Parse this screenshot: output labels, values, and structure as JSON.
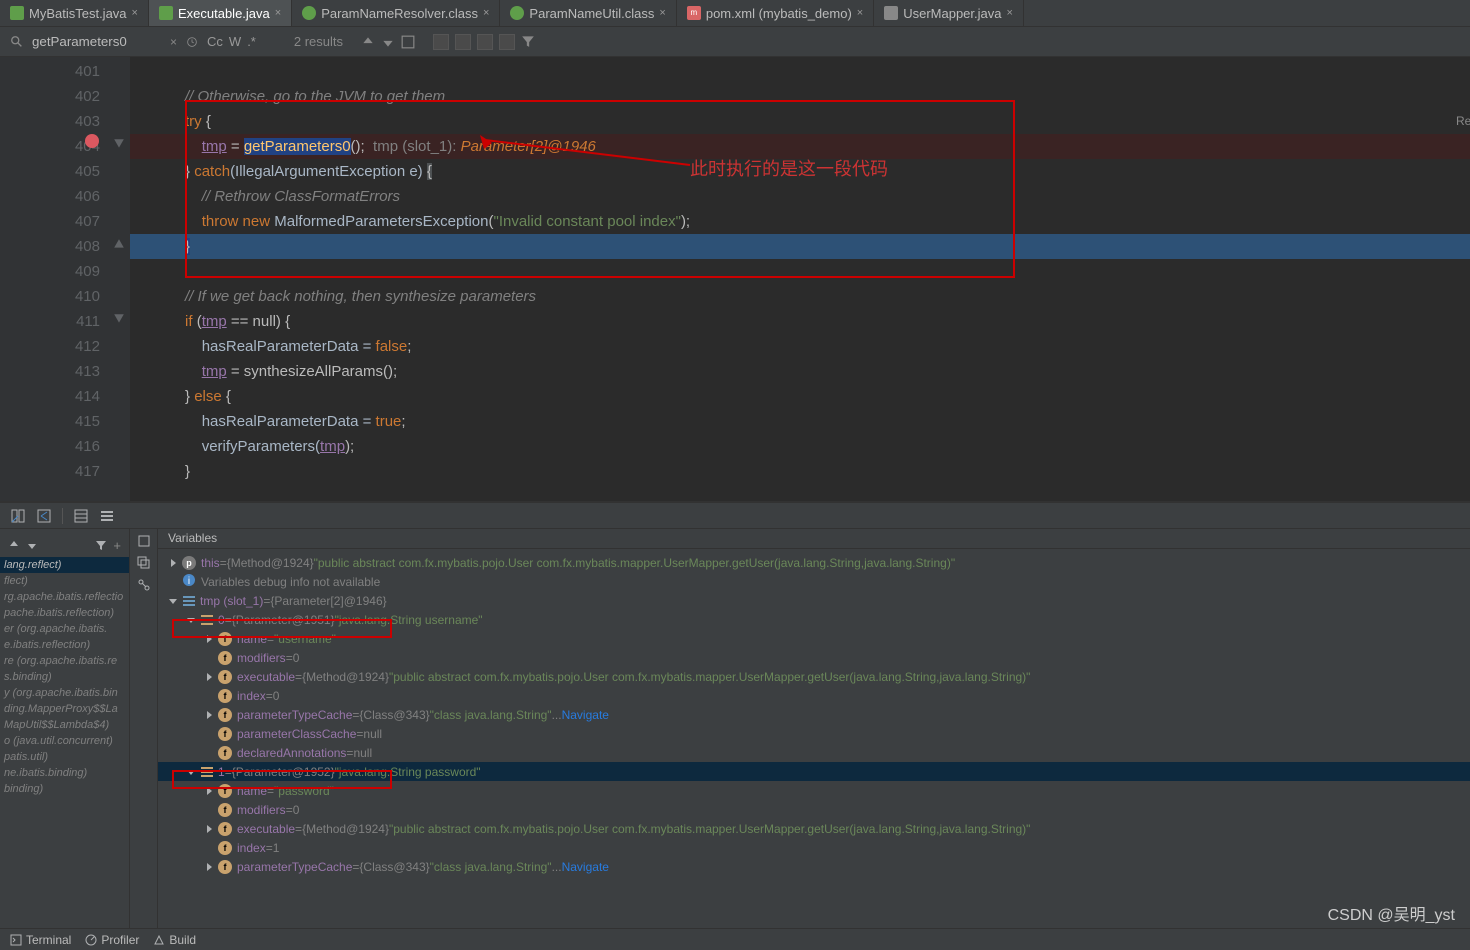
{
  "tabs": [
    {
      "label": "MyBatisTest.java",
      "active": false,
      "type": "java"
    },
    {
      "label": "Executable.java",
      "active": true,
      "type": "java"
    },
    {
      "label": "ParamNameResolver.class",
      "active": false,
      "type": "class"
    },
    {
      "label": "ParamNameUtil.class",
      "active": false,
      "type": "class"
    },
    {
      "label": "pom.xml (mybatis_demo)",
      "active": false,
      "type": "xml"
    },
    {
      "label": "UserMapper.java",
      "active": false,
      "type": "user"
    }
  ],
  "find": {
    "query": "getParameters0",
    "results": "2 results",
    "cc": "Cc",
    "w": "W",
    "re": ".*"
  },
  "lines": [
    "401",
    "402",
    "403",
    "404",
    "405",
    "406",
    "407",
    "408",
    "409",
    "410",
    "411",
    "412",
    "413",
    "414",
    "415",
    "416",
    "417"
  ],
  "code": {
    "l401": "",
    "l402_comment": "// Otherwise, go to the JVM to get them",
    "l403_try": "try",
    "l403_br": " {",
    "l404_tmp": "tmp",
    "l404_eq": " = ",
    "l404_call": "getParameters0",
    "l404_par": "();",
    "l404_inline_lbl": "  tmp (slot_1): ",
    "l404_inline_val": "Parameter[2]@1946",
    "l405_cl": "}",
    "l405_catch": " catch",
    "l405_sig": "(IllegalArgumentException e) ",
    "l405_br": "{",
    "l406_comment": "// Rethrow ClassFormatErrors",
    "l407_throw": "throw new ",
    "l407_ex": "MalformedParametersException",
    "l407_open": "(",
    "l407_str": "\"Invalid constant pool index\"",
    "l407_close": ");",
    "l408": "}",
    "l409": "",
    "l410_comment": "// If we get back nothing, then synthesize parameters",
    "l411_if": "if ",
    "l411_open": "(",
    "l411_tmp": "tmp",
    "l411_cond": " == null) {",
    "l412_var": "hasRealParameterData = ",
    "l412_false": "false",
    "l412_semi": ";",
    "l413_tmp": "tmp",
    "l413_eq": " = synthesizeAllParams();",
    "l414": "} ",
    "l414_else": "else",
    "l414_br": " {",
    "l415_var": "hasRealParameterData = ",
    "l415_true": "true",
    "l415_semi": ";",
    "l416_call": "verifyParameters(",
    "l416_tmp": "tmp",
    "l416_close": ");",
    "l417": "}"
  },
  "annotation": "此时执行的是这一段代码",
  "debug": {
    "variables_title": "Variables",
    "frames": [
      "lang.reflect)",
      "flect)",
      "rg.apache.ibatis.reflectio",
      "pache.ibatis.reflection)",
      "er (org.apache.ibatis.",
      "e.ibatis.reflection)",
      "re (org.apache.ibatis.re",
      "s.binding)",
      "y (org.apache.ibatis.bin",
      "ding.MapperProxy$$La",
      "MapUtil$$Lambda$4)",
      "o (java.util.concurrent)",
      "patis.util)",
      "ne.ibatis.binding)",
      "binding)"
    ],
    "tree": [
      {
        "indent": 0,
        "arrow": "right",
        "icon": "p",
        "name": "this",
        "eq": " = ",
        "ref": "{Method@1924} ",
        "val": "\"public abstract com.fx.mybatis.pojo.User com.fx.mybatis.mapper.UserMapper.getUser(java.lang.String,java.lang.String)\""
      },
      {
        "indent": 0,
        "arrow": "",
        "icon": "info",
        "text": "Variables debug info not available"
      },
      {
        "indent": 0,
        "arrow": "down",
        "icon": "arr",
        "name": "tmp (slot_1)",
        "eq": " = ",
        "ref": "{Parameter[2]@1946}",
        "val": ""
      },
      {
        "indent": 1,
        "arrow": "down",
        "icon": "bars",
        "name": "0",
        "eq": " = ",
        "ref": "{Parameter@1951} ",
        "val": "\"java.lang.String username\""
      },
      {
        "indent": 2,
        "arrow": "right",
        "icon": "f",
        "name": "name",
        "eq": " = ",
        "val": "\"username\"",
        "boxed": true
      },
      {
        "indent": 2,
        "arrow": "",
        "icon": "f",
        "name": "modifiers",
        "eq": " = ",
        "val": "0"
      },
      {
        "indent": 2,
        "arrow": "right",
        "icon": "f",
        "name": "executable",
        "eq": " = ",
        "ref": "{Method@1924} ",
        "val": "\"public abstract com.fx.mybatis.pojo.User com.fx.mybatis.mapper.UserMapper.getUser(java.lang.String,java.lang.String)\""
      },
      {
        "indent": 2,
        "arrow": "",
        "icon": "f",
        "name": "index",
        "eq": " = ",
        "val": "0"
      },
      {
        "indent": 2,
        "arrow": "right",
        "icon": "f",
        "name": "parameterTypeCache",
        "eq": " = ",
        "ref": "{Class@343} ",
        "val": "\"class java.lang.String\"",
        "link": "Navigate"
      },
      {
        "indent": 2,
        "arrow": "",
        "icon": "f",
        "name": "parameterClassCache",
        "eq": " = ",
        "val": "null"
      },
      {
        "indent": 2,
        "arrow": "",
        "icon": "f",
        "name": "declaredAnnotations",
        "eq": " = ",
        "val": "null"
      },
      {
        "indent": 1,
        "arrow": "down",
        "icon": "bars",
        "name": "1",
        "eq": " = ",
        "ref": "{Parameter@1952} ",
        "val": "\"java.lang.String password\"",
        "sel": true
      },
      {
        "indent": 2,
        "arrow": "right",
        "icon": "f",
        "name": "name",
        "eq": " = ",
        "val": "\"password\"",
        "boxed": true
      },
      {
        "indent": 2,
        "arrow": "",
        "icon": "f",
        "name": "modifiers",
        "eq": " = ",
        "val": "0"
      },
      {
        "indent": 2,
        "arrow": "right",
        "icon": "f",
        "name": "executable",
        "eq": " = ",
        "ref": "{Method@1924} ",
        "val": "\"public abstract com.fx.mybatis.pojo.User com.fx.mybatis.mapper.UserMapper.getUser(java.lang.String,java.lang.String)\""
      },
      {
        "indent": 2,
        "arrow": "",
        "icon": "f",
        "name": "index",
        "eq": " = ",
        "val": "1"
      },
      {
        "indent": 2,
        "arrow": "right",
        "icon": "f",
        "name": "parameterTypeCache",
        "eq": " = ",
        "ref": "{Class@343} ",
        "val": "\"class java.lang.String\"",
        "link": "Navigate"
      }
    ]
  },
  "bottom": {
    "terminal": "Terminal",
    "profiler": "Profiler",
    "build": "Build"
  },
  "watermark": "CSDN @吴明_yst",
  "right_edge": "Re"
}
